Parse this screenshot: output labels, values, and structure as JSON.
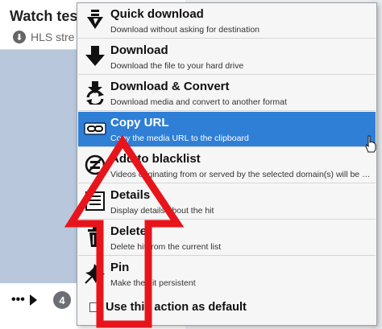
{
  "background": {
    "title": "Watch tes",
    "subtitle": "HLS stre",
    "dots": "•••",
    "badge": "4"
  },
  "menu": {
    "items": [
      {
        "id": "quick-download",
        "label": "Quick download",
        "desc": "Download without asking for destination",
        "icon": "quick-download-icon"
      },
      {
        "id": "download",
        "label": "Download",
        "desc": "Download the file to your hard drive",
        "icon": "download-arrow-icon"
      },
      {
        "id": "download-convert",
        "label": "Download & Convert",
        "desc": "Download media and convert to another format",
        "icon": "download-convert-icon"
      },
      {
        "id": "copy-url",
        "label": "Copy URL",
        "desc": "Copy the media URL to the clipboard",
        "icon": "link-icon",
        "active": true
      },
      {
        "id": "add-blacklist",
        "label": "Add to blacklist",
        "desc": "Videos originating from or served by the selected domain(s) will be ignor...",
        "icon": "blacklist-icon"
      },
      {
        "id": "details",
        "label": "Details",
        "desc": "Display details about the hit",
        "icon": "details-icon"
      },
      {
        "id": "delete",
        "label": "Delete",
        "desc": "Delete hit from the current list",
        "icon": "trash-icon"
      },
      {
        "id": "pin",
        "label": "Pin",
        "desc": "Make the hit persistent",
        "icon": "pin-icon"
      }
    ],
    "footer_label": "Use this action as default"
  },
  "colors": {
    "active": "#2f7fd6",
    "annotation": "#e8141b"
  }
}
